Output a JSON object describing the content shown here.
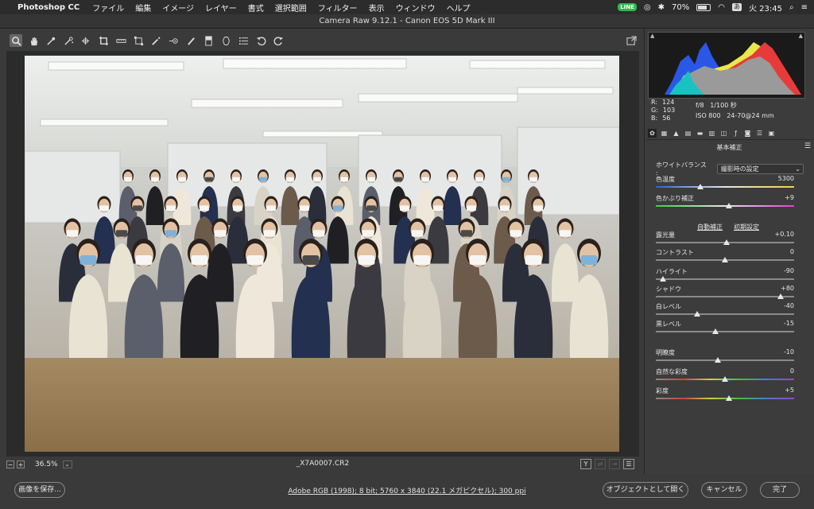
{
  "menubar": {
    "app_name": "Photoshop CC",
    "items": [
      "ファイル",
      "編集",
      "イメージ",
      "レイヤー",
      "書式",
      "選択範囲",
      "フィルター",
      "表示",
      "ウィンドウ",
      "ヘルプ"
    ],
    "battery": "70%",
    "input_badge": "あ",
    "clock": "火 23:45",
    "line_label": "LINE"
  },
  "window": {
    "title": "Camera Raw 9.12.1  -  Canon EOS 5D Mark III"
  },
  "image": {
    "zoom": "36.5%",
    "filename": "_X7A0007.CR2",
    "y_icon": "Y"
  },
  "workflow_link": "Adobe RGB (1998); 8 bit; 5760 x 3840 (22.1 メガピクセル); 300 ppi",
  "buttons": {
    "save": "画像を保存...",
    "open_object": "オブジェクトとして開く",
    "cancel": "キャンセル",
    "done": "完了"
  },
  "readout": {
    "r_label": "R:",
    "r_value": "124",
    "g_label": "G:",
    "g_value": "103",
    "b_label": "B:",
    "b_value": "56",
    "aperture": "f/8",
    "shutter": "1/100 秒",
    "iso": "ISO 800",
    "lens": "24-70@24 mm"
  },
  "panel": {
    "section_title": "基本補正",
    "wb_label": "ホワイトバランス :",
    "wb_value": "撮影時の設定",
    "auto_label": "自動補正",
    "default_label": "初期設定",
    "sliders": [
      {
        "key": "temp",
        "label": "色温度",
        "value": "5300",
        "pos": 0.32,
        "track": "temp"
      },
      {
        "key": "tint",
        "label": "色かぶり補正",
        "value": "+9",
        "pos": 0.53,
        "track": "tint"
      },
      {
        "key": "exposure",
        "label": "露光量",
        "value": "+0.10",
        "pos": 0.51,
        "track": "plain"
      },
      {
        "key": "contrast",
        "label": "コントラスト",
        "value": "0",
        "pos": 0.5,
        "track": "plain"
      },
      {
        "key": "highlights",
        "label": "ハイライト",
        "value": "-90",
        "pos": 0.05,
        "track": "plain"
      },
      {
        "key": "shadows",
        "label": "シャドウ",
        "value": "+80",
        "pos": 0.9,
        "track": "plain"
      },
      {
        "key": "whites",
        "label": "白レベル",
        "value": "-40",
        "pos": 0.3,
        "track": "plain"
      },
      {
        "key": "blacks",
        "label": "黒レベル",
        "value": "-15",
        "pos": 0.43,
        "track": "plain"
      },
      {
        "key": "clarity",
        "label": "明瞭度",
        "value": "-10",
        "pos": 0.45,
        "track": "plain"
      },
      {
        "key": "vibrance",
        "label": "自然な彩度",
        "value": "0",
        "pos": 0.5,
        "track": "vib"
      },
      {
        "key": "saturation",
        "label": "彩度",
        "value": "+5",
        "pos": 0.53,
        "track": "sat"
      }
    ]
  },
  "colors": {
    "panel_bg": "#3c3c3c",
    "app_bg": "#3a3a3a",
    "image_bg": "#2b2b2b"
  }
}
